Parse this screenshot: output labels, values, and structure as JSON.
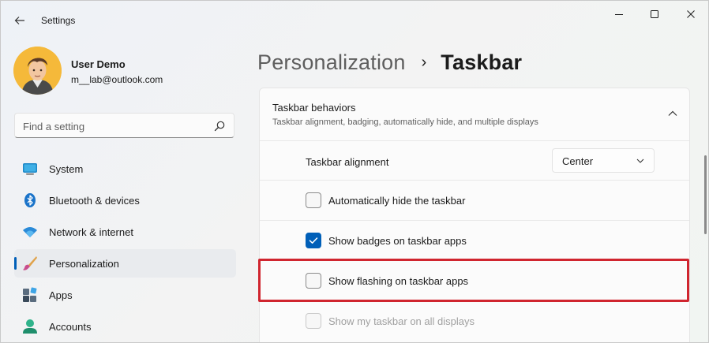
{
  "window": {
    "app_title": "Settings",
    "controls": {
      "minimize": "minimize-icon",
      "maximize": "maximize-icon",
      "close": "close-icon"
    }
  },
  "profile": {
    "name": "User Demo",
    "email": "m__lab@outlook.com"
  },
  "search": {
    "placeholder": "Find a setting"
  },
  "sidebar": {
    "items": [
      {
        "label": "System",
        "icon": "system-monitor-icon"
      },
      {
        "label": "Bluetooth & devices",
        "icon": "bluetooth-icon"
      },
      {
        "label": "Network & internet",
        "icon": "wifi-icon"
      },
      {
        "label": "Personalization",
        "icon": "paintbrush-icon",
        "selected": true
      },
      {
        "label": "Apps",
        "icon": "apps-icon"
      },
      {
        "label": "Accounts",
        "icon": "person-icon"
      }
    ]
  },
  "breadcrumb": {
    "parent": "Personalization",
    "separator": "›",
    "current": "Taskbar"
  },
  "section": {
    "title": "Taskbar behaviors",
    "subtitle": "Taskbar alignment, badging, automatically hide, and multiple displays",
    "expanded": true
  },
  "settings": {
    "alignment": {
      "label": "Taskbar alignment",
      "value": "Center"
    },
    "auto_hide": {
      "label": "Automatically hide the taskbar",
      "checked": false
    },
    "badges": {
      "label": "Show badges on taskbar apps",
      "checked": true
    },
    "flashing": {
      "label": "Show flashing on taskbar apps",
      "checked": false,
      "highlighted": true
    },
    "all_displays": {
      "label": "Show my taskbar on all displays",
      "checked": false,
      "disabled": true
    }
  },
  "colors": {
    "accent": "#005fb8",
    "highlight_border": "#d0252f"
  }
}
